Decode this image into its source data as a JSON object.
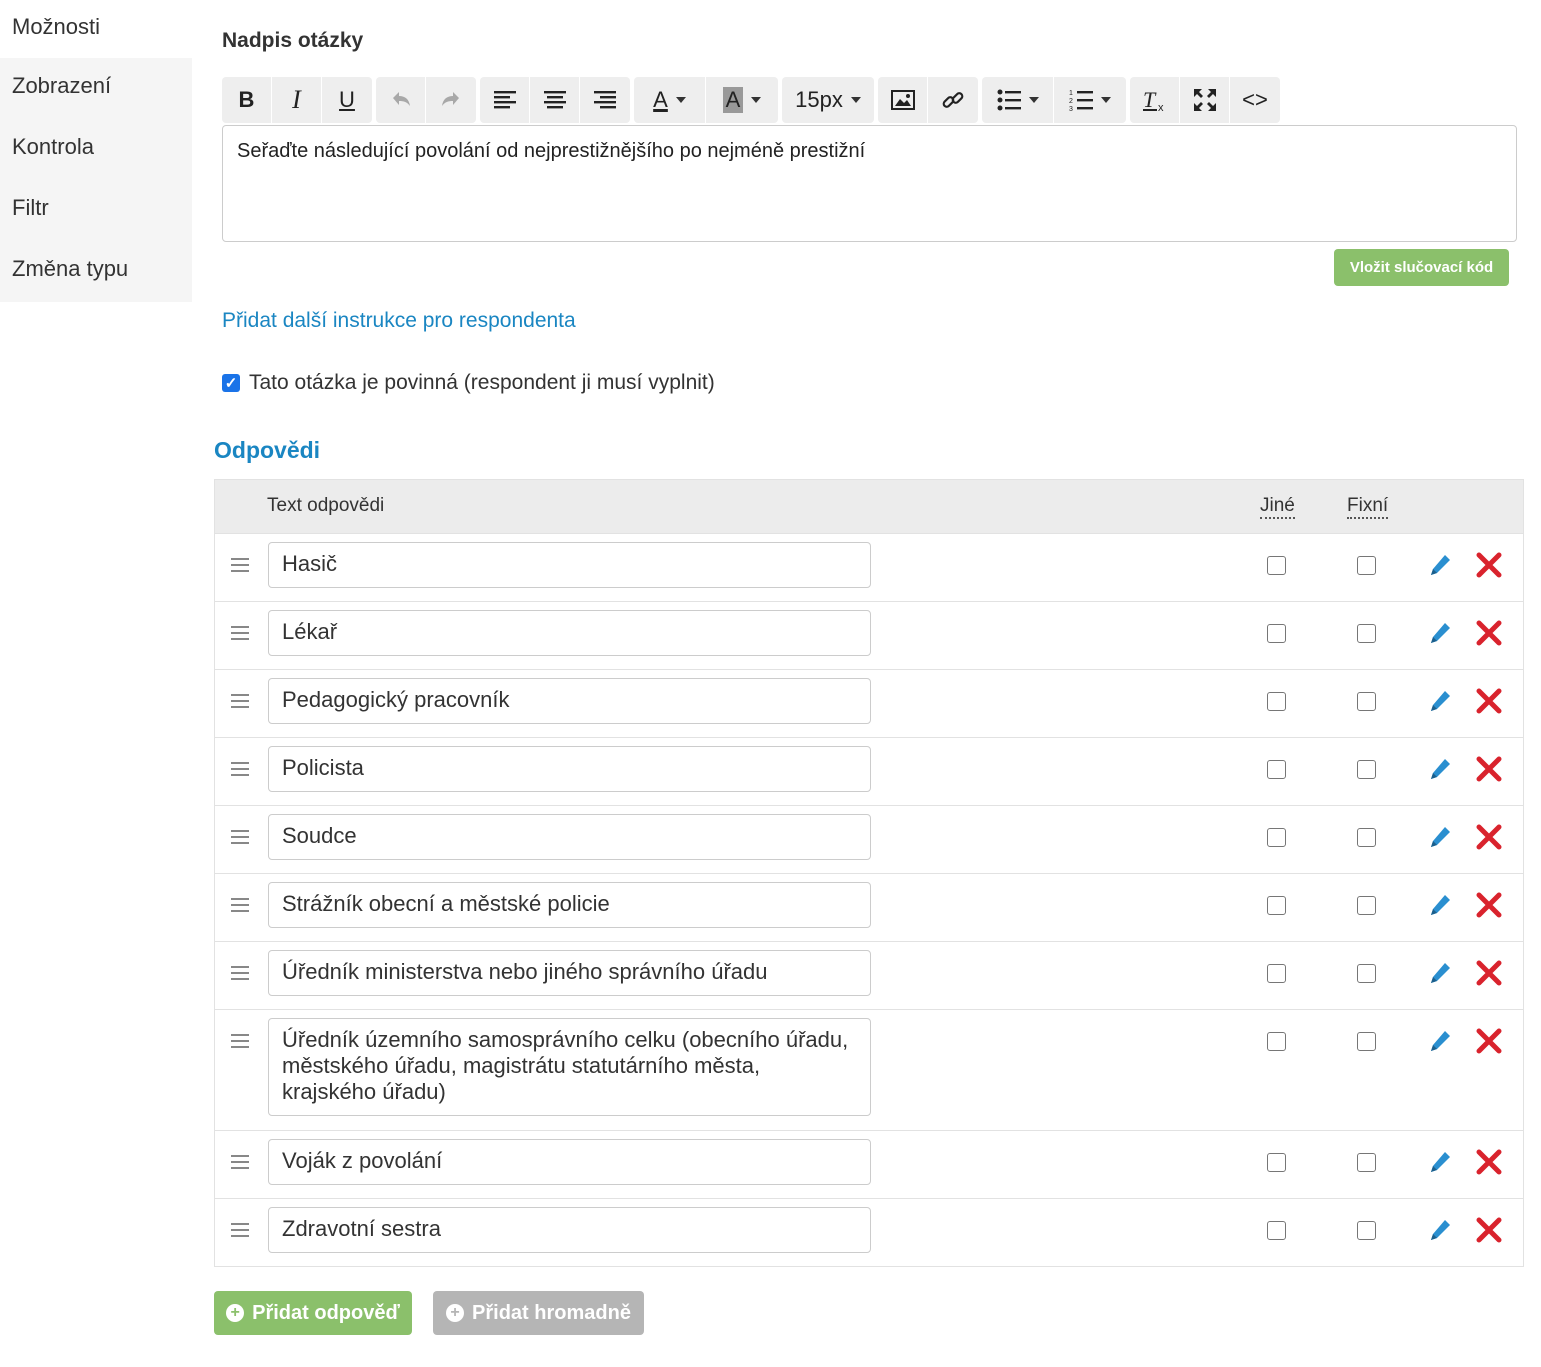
{
  "sidebar": {
    "items": [
      {
        "label": "Možnosti"
      },
      {
        "label": "Zobrazení"
      },
      {
        "label": "Kontrola"
      },
      {
        "label": "Filtr"
      },
      {
        "label": "Změna typu"
      }
    ]
  },
  "question": {
    "title_label": "Nadpis otázky",
    "text": "Seřaďte následující povolání od nejprestižnějšího po nejméně prestižní",
    "merge_button": "Vložit slučovací kód",
    "instructions_link": "Přidat další instrukce pro respondenta",
    "required_label": "Tato otázka je povinná (respondent ji musí vyplnit)",
    "required_checked": true
  },
  "toolbar": {
    "bold": "B",
    "italic": "I",
    "underline": "U",
    "font_color": "A",
    "bg_color": "A",
    "font_size": "15px",
    "code": "<>"
  },
  "answers": {
    "title": "Odpovědi",
    "col_text": "Text odpovědi",
    "col_other": "Jiné",
    "col_fixed": "Fixní",
    "rows": [
      {
        "text": "Hasič"
      },
      {
        "text": "Lékař"
      },
      {
        "text": "Pedagogický pracovník"
      },
      {
        "text": "Policista"
      },
      {
        "text": "Soudce"
      },
      {
        "text": "Strážník obecní a městské policie"
      },
      {
        "text": "Úředník ministerstva nebo jiného správního úřadu"
      },
      {
        "text": "Úředník územního samosprávního celku (obecního úřadu, městského úřadu, magistrátu statutárního města, krajského úřadu)"
      },
      {
        "text": "Voják z povolání"
      },
      {
        "text": "Zdravotní sestra"
      }
    ],
    "add_button": "Přidat odpověď",
    "bulk_button": "Přidat hromadně"
  },
  "colors": {
    "accent_blue": "#1a86c2",
    "green": "#8bc06b",
    "delete_red": "#d9232d",
    "edit_blue": "#2a8fd0"
  }
}
